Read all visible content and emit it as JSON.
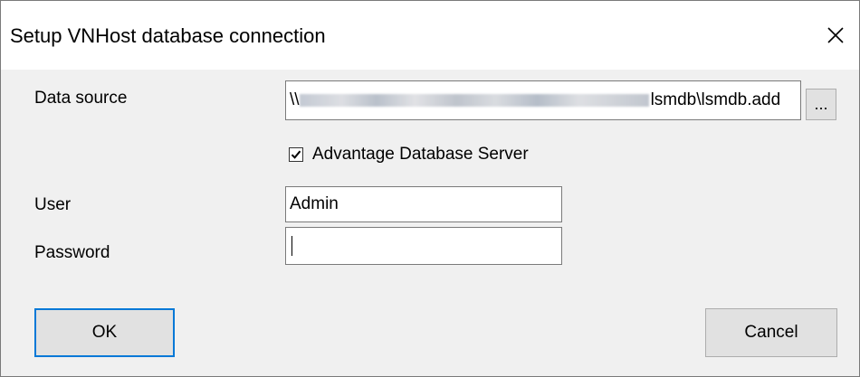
{
  "window": {
    "title": "Setup VNHost database connection",
    "close_icon": "close-icon"
  },
  "form": {
    "data_source_label": "Data source",
    "data_source_value_tail": "lsmdb\\lsmdb.add",
    "data_source_prefix": "\\\\",
    "browse_label": "...",
    "ads_checkbox_label": "Advantage Database Server",
    "ads_checked": true,
    "user_label": "User",
    "user_value": "Admin",
    "password_label": "Password",
    "password_value": ""
  },
  "buttons": {
    "ok_label": "OK",
    "cancel_label": "Cancel"
  },
  "colors": {
    "accent": "#0078d7",
    "dialog_bg": "#f0f0f0",
    "titlebar_bg": "#ffffff"
  }
}
